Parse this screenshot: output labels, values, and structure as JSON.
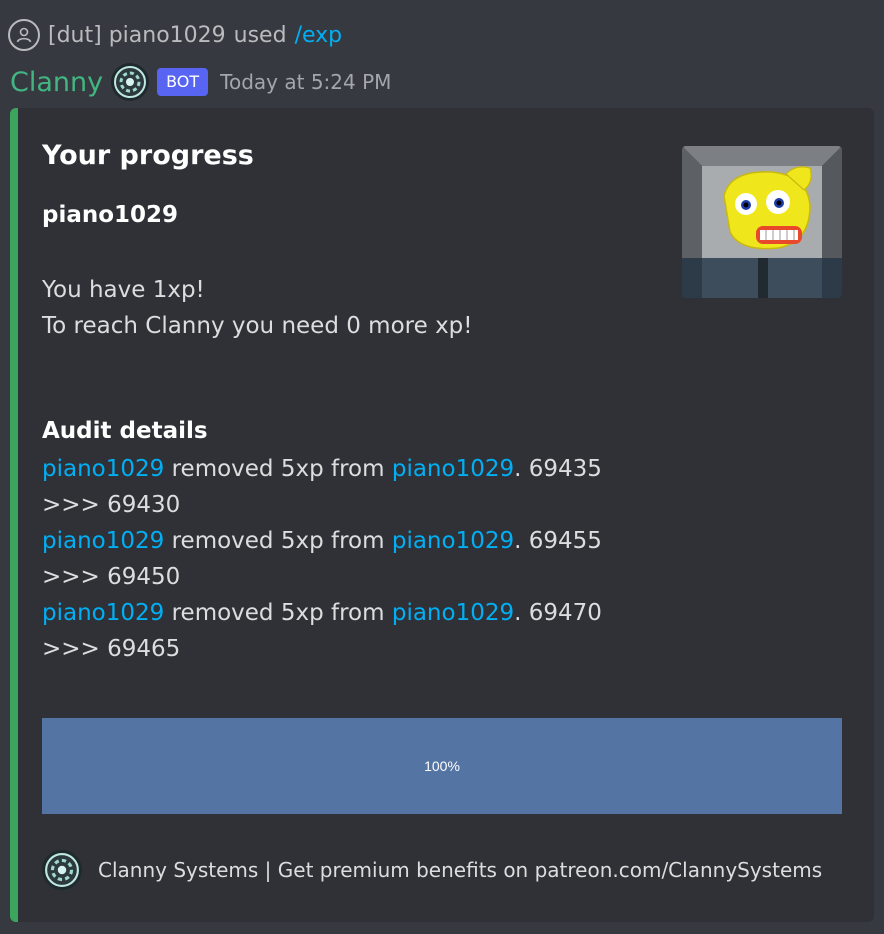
{
  "reply": {
    "user": "[dut] piano1029",
    "action": "used",
    "command": "/exp",
    "avatar_icon": "user-icon"
  },
  "message": {
    "author": "Clanny",
    "badge": "BOT",
    "timestamp": "Today at 5:24 PM",
    "author_color": "#43b581"
  },
  "embed": {
    "accent_color": "#3ba55d",
    "title": "Your progress",
    "user_field_name": "piano1029",
    "xp_line": "You have 1xp!",
    "reach_line": "To reach Clanny you need 0 more xp!",
    "audit_title": "Audit details",
    "audit_entries": [
      {
        "actor": "piano1029",
        "action": " removed 5xp from ",
        "target": "piano1029",
        "detail": ". 69435",
        "result": ">>> 69430"
      },
      {
        "actor": "piano1029",
        "action": " removed 5xp from ",
        "target": "piano1029",
        "detail": ". 69455",
        "result": ">>> 69450"
      },
      {
        "actor": "piano1029",
        "action": " removed 5xp from ",
        "target": "piano1029",
        "detail": ". 69470",
        "result": ">>> 69465"
      }
    ],
    "progress_label": "100%",
    "progress_value": 1.0,
    "progress_color": "#5474a3",
    "footer_text": "Clanny Systems | Get premium benefits on patreon.com/ClannySystems",
    "footer_icon": "clanny-logo-icon"
  }
}
